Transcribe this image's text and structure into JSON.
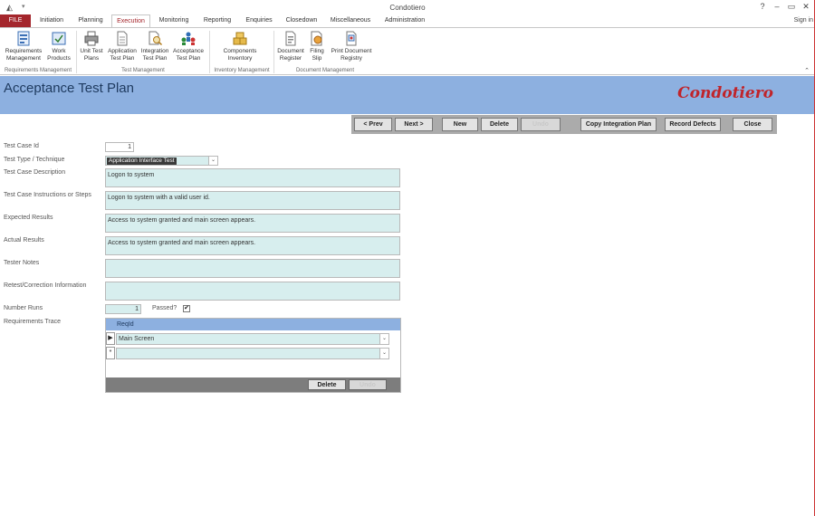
{
  "window": {
    "title": "Condotiero",
    "help": "?",
    "minimize": "–",
    "restore": "▭",
    "close": "✕",
    "sign_in": "Sign in"
  },
  "ribbon_tabs": [
    {
      "label": "FILE"
    },
    {
      "label": "Initiation"
    },
    {
      "label": "Planning"
    },
    {
      "label": "Execution"
    },
    {
      "label": "Monitoring"
    },
    {
      "label": "Reporting"
    },
    {
      "label": "Enquiries"
    },
    {
      "label": "Closedown"
    },
    {
      "label": "Miscellaneous"
    },
    {
      "label": "Administration"
    }
  ],
  "ribbon": {
    "buttons": [
      {
        "label": "Requirements Management",
        "icon": "requirements-icon"
      },
      {
        "label": "Work Products",
        "icon": "work-products-icon"
      },
      {
        "label": "Unit Test Plans",
        "icon": "printer-icon"
      },
      {
        "label": "Application Test Plan",
        "icon": "document-icon"
      },
      {
        "label": "Integration Test Plan",
        "icon": "search-document-icon"
      },
      {
        "label": "Acceptance Test Plan",
        "icon": "people-icon"
      },
      {
        "label": "Components Inventory",
        "icon": "boxes-icon"
      },
      {
        "label": "Document Register",
        "icon": "register-icon"
      },
      {
        "label": "Filing Slip",
        "icon": "filing-slip-icon"
      },
      {
        "label": "Print Document Registry",
        "icon": "print-registry-icon"
      }
    ],
    "groups": [
      {
        "label": "Requirements Management"
      },
      {
        "label": "Test Management"
      },
      {
        "label": "Inventory Management"
      },
      {
        "label": "Document Management"
      }
    ],
    "collapse_glyph": "⌃"
  },
  "header": {
    "title": "Acceptance Test Plan",
    "brand": "Condotiero"
  },
  "toolbar": {
    "prev": "< Prev",
    "next": "Next >",
    "new": "New",
    "delete": "Delete",
    "undo": "Undo",
    "copy": "Copy Integration Plan",
    "record": "Record Defects",
    "close": "Close"
  },
  "form": {
    "labels": {
      "test_case_id": "Test Case Id",
      "technique": "Test Type / Technique",
      "description": "Test Case Description",
      "instructions": "Test Case Instructions or Steps",
      "expected": "Expected Results",
      "actual": "Actual Results",
      "tester_notes": "Tester Notes",
      "retest": "Retest/Correction Information",
      "number_runs": "Number Runs",
      "requirements_trace": "Requirements Trace"
    },
    "values": {
      "test_case_id": "1",
      "technique": "Application Interface Test",
      "description": "Logon to system",
      "instructions": "Logon to system with a valid user id.",
      "expected": "Access to system granted and main screen appears.",
      "actual": "Access to system granted and main screen appears.",
      "tester_notes": "",
      "retest": "",
      "number_runs": "1"
    },
    "passed_label": "Passed?",
    "passed_checked": true,
    "check_glyph": "✔"
  },
  "subform": {
    "column": "ReqId",
    "rows": [
      {
        "selector": "▶",
        "value": "Main Screen"
      },
      {
        "selector": "*",
        "value": ""
      }
    ],
    "dropdown_glyph": "⌄",
    "delete": "Delete",
    "undo": "Undo"
  },
  "colors": {
    "accent": "#a4262c",
    "header_band": "#8db0e0",
    "field_bg": "#d7eeee",
    "brand": "#c0242a"
  }
}
